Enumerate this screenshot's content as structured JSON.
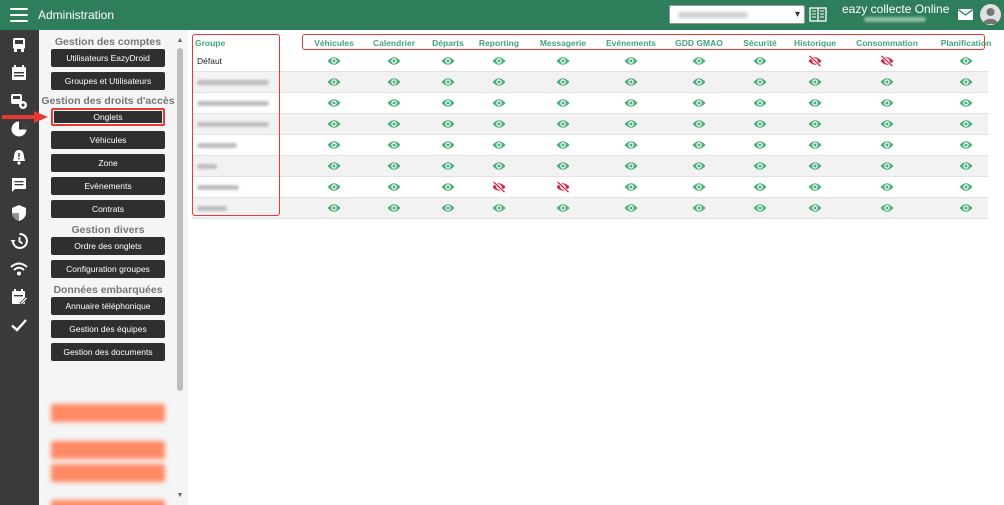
{
  "app": {
    "title": "Administration"
  },
  "header": {
    "select_value": "",
    "user_name": "eazy collecte Online",
    "icons": [
      "menu-icon",
      "book-icon",
      "mail-icon",
      "user-avatar-icon"
    ]
  },
  "colors": {
    "brand": "#2e7d5b",
    "accent_green": "#43a47a",
    "eye_green": "#4caf7d",
    "eye_off_red": "#c62848",
    "highlight_red": "#e53935",
    "dark_button": "#2f2f2f"
  },
  "nav_icons": [
    "bus-icon",
    "calendar-list-icon",
    "bus-settings-icon",
    "pie-chart-icon",
    "bell-alert-icon",
    "message-icon",
    "shield-icon",
    "history-icon",
    "wifi-settings-icon",
    "calendar-edit-icon",
    "check-icon"
  ],
  "menu": {
    "sections": [
      {
        "title": "Gestion des comptes",
        "items": [
          "Utilisateurs EazyDroid",
          "Groupes et Utilisateurs"
        ]
      },
      {
        "title": "Gestion des droits d'accès",
        "items": [
          "Onglets",
          "Véhicules",
          "Zone",
          "Evènements",
          "Contrats"
        ]
      },
      {
        "title": "Gestion divers",
        "items": [
          "Ordre des onglets",
          "Configuration groupes"
        ]
      },
      {
        "title": "Données embarquées",
        "items": [
          "Annuaire téléphonique",
          "Gestion des équipes",
          "Gestion des documents"
        ]
      }
    ],
    "active_item": "Onglets"
  },
  "table": {
    "group_header": "Groupe",
    "columns": [
      "Véhicules",
      "Calendrier",
      "Départs",
      "Reporting",
      "Messagerie",
      "Evénements",
      "GDD GMAO",
      "Sécurité",
      "Historique",
      "Consommation",
      "Planification"
    ],
    "rows": [
      {
        "name": "Défaut",
        "visible": [
          true,
          true,
          true,
          true,
          true,
          true,
          true,
          true,
          false,
          false,
          true
        ]
      },
      {
        "name": "",
        "visible": [
          true,
          true,
          true,
          true,
          true,
          true,
          true,
          true,
          true,
          true,
          true
        ]
      },
      {
        "name": "",
        "visible": [
          true,
          true,
          true,
          true,
          true,
          true,
          true,
          true,
          true,
          true,
          true
        ]
      },
      {
        "name": "",
        "visible": [
          true,
          true,
          true,
          true,
          true,
          true,
          true,
          true,
          true,
          true,
          true
        ]
      },
      {
        "name": "",
        "visible": [
          true,
          true,
          true,
          true,
          true,
          true,
          true,
          true,
          true,
          true,
          true
        ]
      },
      {
        "name": "",
        "visible": [
          true,
          true,
          true,
          true,
          true,
          true,
          true,
          true,
          true,
          true,
          true
        ]
      },
      {
        "name": "",
        "visible": [
          true,
          true,
          true,
          false,
          false,
          true,
          true,
          true,
          true,
          true,
          true
        ]
      },
      {
        "name": "",
        "visible": [
          true,
          true,
          true,
          true,
          true,
          true,
          true,
          true,
          true,
          true,
          true
        ]
      }
    ]
  }
}
